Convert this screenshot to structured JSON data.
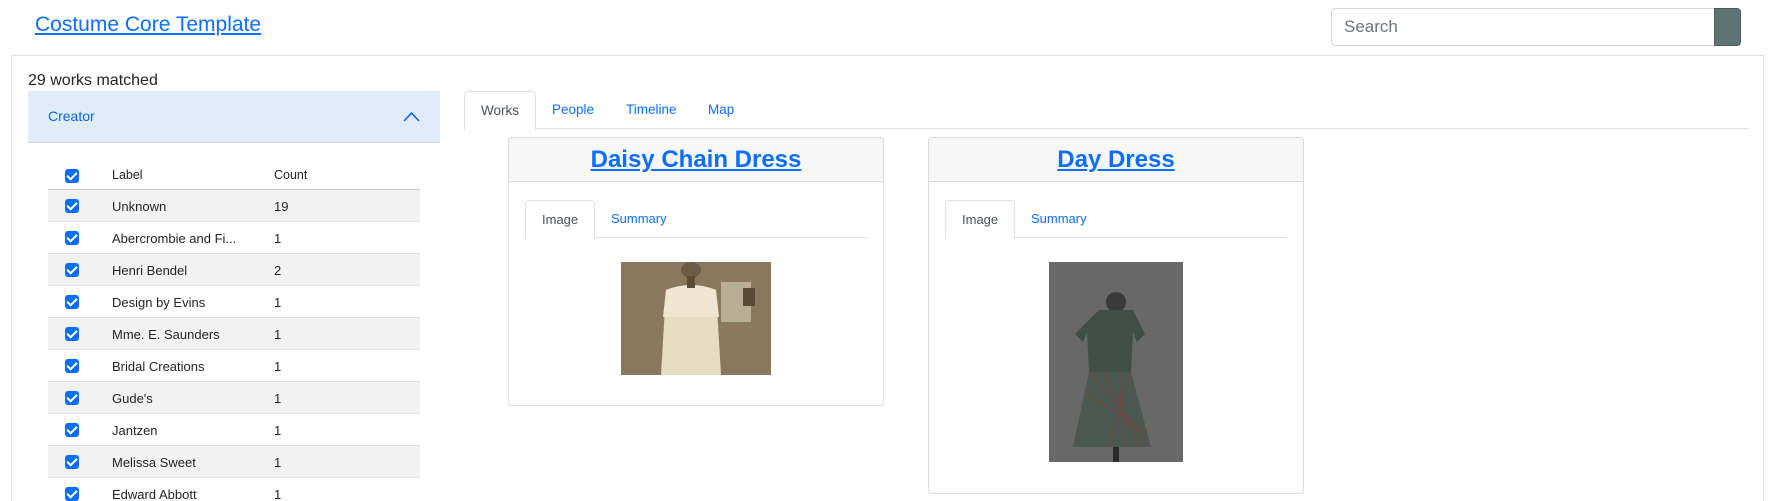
{
  "header": {
    "site_title": "Costume Core Template",
    "search_placeholder": "Search"
  },
  "results": {
    "match_count": "29 works matched"
  },
  "facet": {
    "title": "Creator",
    "columns": {
      "label": "Label",
      "count": "Count"
    },
    "rows": [
      {
        "label": "Unknown",
        "count": "19",
        "checked": true
      },
      {
        "label": "Abercrombie and Fi...",
        "count": "1",
        "checked": true
      },
      {
        "label": "Henri Bendel",
        "count": "2",
        "checked": true
      },
      {
        "label": "Design by Evins",
        "count": "1",
        "checked": true
      },
      {
        "label": "Mme. E. Saunders",
        "count": "1",
        "checked": true
      },
      {
        "label": "Bridal Creations",
        "count": "1",
        "checked": true
      },
      {
        "label": "Gude's",
        "count": "1",
        "checked": true
      },
      {
        "label": "Jantzen",
        "count": "1",
        "checked": true
      },
      {
        "label": "Melissa Sweet",
        "count": "1",
        "checked": true
      },
      {
        "label": "Edward Abbott",
        "count": "1",
        "checked": true
      }
    ]
  },
  "tabs": {
    "works": "Works",
    "people": "People",
    "timeline": "Timeline",
    "map": "Map",
    "active": "Works"
  },
  "cards": [
    {
      "title": "Daisy Chain Dress",
      "tab_image": "Image",
      "tab_summary": "Summary",
      "active_tab": "Image",
      "image_icon": "dress-photo-icon"
    },
    {
      "title": "Day Dress",
      "tab_image": "Image",
      "tab_summary": "Summary",
      "active_tab": "Image",
      "image_icon": "dress-photo-icon"
    }
  ],
  "colors": {
    "link": "#0d6efd",
    "accordion_bg": "#e1ecfb",
    "search_button": "#5c7573"
  }
}
